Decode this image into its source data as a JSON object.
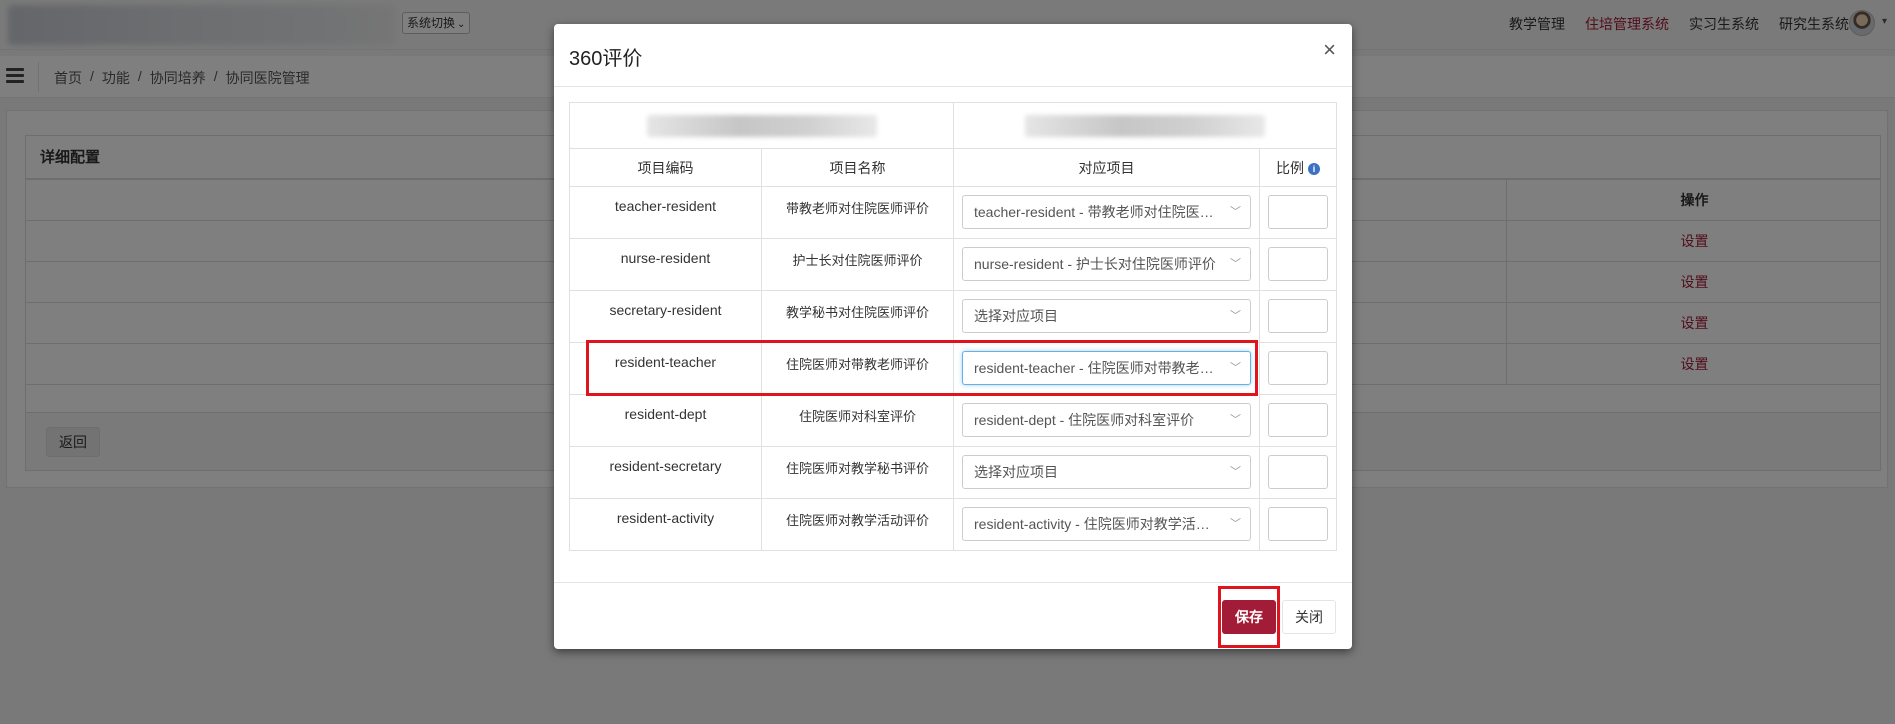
{
  "topbar": {
    "system_switch": "系统切换",
    "nav": [
      {
        "label": "教学管理",
        "active": false
      },
      {
        "label": "住培管理系统",
        "active": true
      },
      {
        "label": "实习生系统",
        "active": false
      },
      {
        "label": "研究生系统",
        "active": false
      }
    ]
  },
  "breadcrumb": [
    "首页",
    "/",
    "功能",
    "/",
    "协同培养",
    "/",
    "协同医院管理"
  ],
  "page": {
    "panel_title": "详细配置",
    "op_header": "操作",
    "rows": [
      {
        "op": "设置"
      },
      {
        "op": "设置"
      },
      {
        "op": "设置"
      },
      {
        "op": "设置"
      }
    ],
    "back_label": "返回"
  },
  "modal": {
    "title": "360评价",
    "close_symbol": "×",
    "headers": {
      "code": "项目编码",
      "name": "项目名称",
      "mapping": "对应项目",
      "ratio": "比例"
    },
    "rows": [
      {
        "code": "teacher-resident",
        "name": "带教老师对住院医师评价",
        "selected": "teacher-resident - 带教老师对住院医师评价"
      },
      {
        "code": "nurse-resident",
        "name": "护士长对住院医师评价",
        "selected": "nurse-resident - 护士长对住院医师评价"
      },
      {
        "code": "secretary-resident",
        "name": "教学秘书对住院医师评价",
        "selected": "选择对应项目"
      },
      {
        "code": "resident-teacher",
        "name": "住院医师对带教老师评价",
        "selected": "resident-teacher - 住院医师对带教老师评价"
      },
      {
        "code": "resident-dept",
        "name": "住院医师对科室评价",
        "selected": "resident-dept - 住院医师对科室评价"
      },
      {
        "code": "resident-secretary",
        "name": "住院医师对教学秘书评价",
        "selected": "选择对应项目"
      },
      {
        "code": "resident-activity",
        "name": "住院医师对教学活动评价",
        "selected": "resident-activity - 住院医师对教学活动评价"
      }
    ],
    "save_label": "保存",
    "close_label": "关闭"
  },
  "colors": {
    "brand": "#a31c37",
    "highlight": "#e0141e",
    "info": "#3b72c4"
  }
}
